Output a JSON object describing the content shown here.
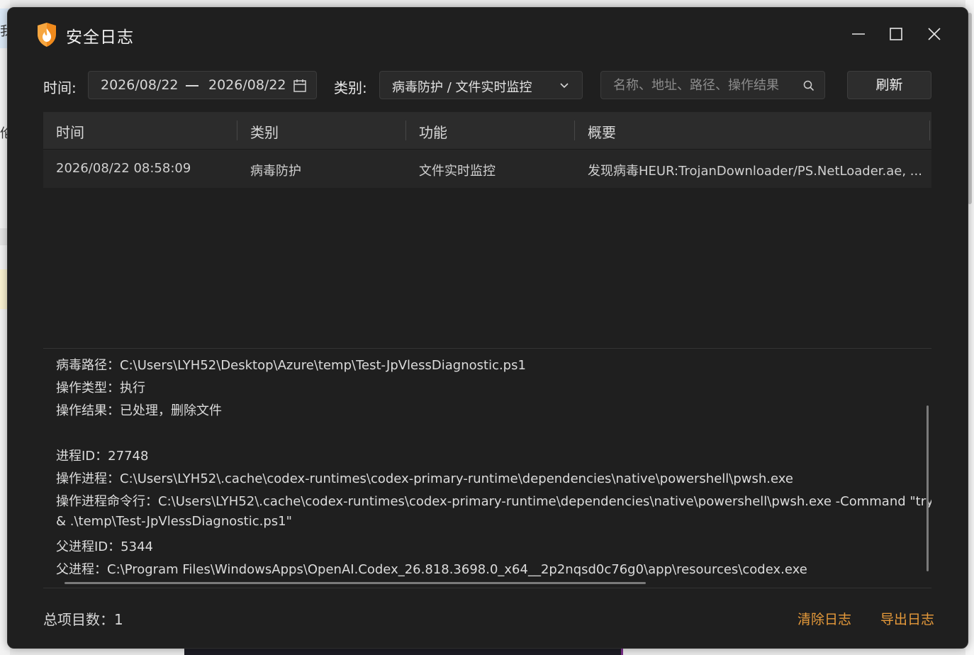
{
  "window": {
    "title": "安全日志"
  },
  "background": {
    "left_fragment_1": "我",
    "left_fragment_2": "伦"
  },
  "filters": {
    "time_label": "时间:",
    "date_start": "2026/08/22",
    "date_end": "2026/08/22",
    "category_label": "类别:",
    "category_value": "病毒防护 / 文件实时监控",
    "search_placeholder": "名称、地址、路径、操作结果",
    "search_value": "",
    "refresh_label": "刷新"
  },
  "table": {
    "headers": [
      "时间",
      "类别",
      "功能",
      "概要"
    ],
    "rows": [
      {
        "time": "2026/08/22 08:58:09",
        "category": "病毒防护",
        "function": "文件实时监控",
        "summary": "发现病毒HEUR:TrojanDownloader/PS.NetLoader.ae, ..."
      }
    ]
  },
  "detail": {
    "lines": [
      "病毒路径：C:\\Users\\LYH52\\Desktop\\Azure\\temp\\Test-JpVlessDiagnostic.ps1",
      "操作类型：执行",
      "操作结果：已处理，删除文件",
      "",
      "进程ID：27748",
      "操作进程：C:\\Users\\LYH52\\.cache\\codex-runtimes\\codex-primary-runtime\\dependencies\\native\\powershell\\pwsh.exe",
      "操作进程命令行：C:\\Users\\LYH52\\.cache\\codex-runtimes\\codex-primary-runtime\\dependencies\\native\\powershell\\pwsh.exe -Command \"try { [Console]::OutputEncoding = [System.Text.Encoding]::UTF8 } catch {} ;",
      "& .\\temp\\Test-JpVlessDiagnostic.ps1\"",
      "父进程ID：5344",
      "父进程：C:\\Program Files\\WindowsApps\\OpenAI.Codex_26.818.3698.0_x64__2p2nqsd0c76g0\\app\\resources\\codex.exe"
    ]
  },
  "footer": {
    "count_label": "总项目数：",
    "count_value": "1",
    "clear_label": "清除日志",
    "export_label": "导出日志"
  },
  "colors": {
    "accent": "#e69a3a",
    "window_bg": "#1f1f1f",
    "logo_orange": "#f08a1c"
  }
}
